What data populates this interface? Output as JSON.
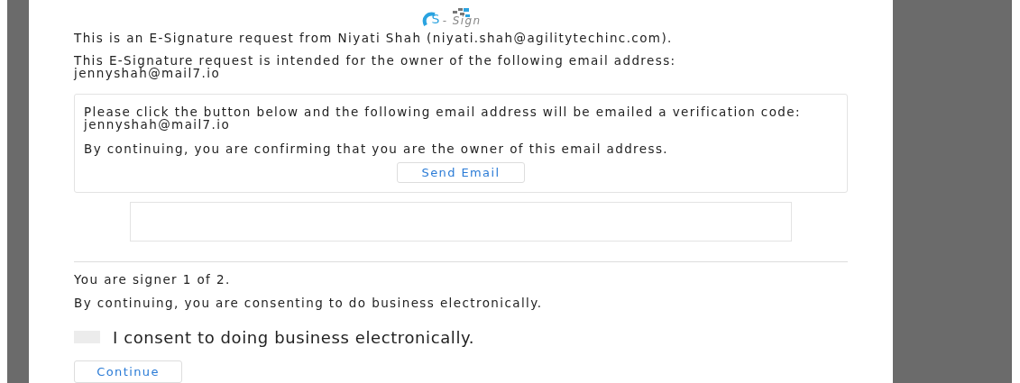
{
  "logo": {
    "letter": "S",
    "word": "- Sign"
  },
  "intro": "This is an E-Signature request from Niyati Shah (niyati.shah@agilitytechinc.com).",
  "intended": "This E-Signature request is intended for the owner of the following email address:",
  "intended_email": "jennyshah@mail7.io",
  "verify_card": {
    "text": "Please click the button below and the following email address will be emailed a verification code: jennyshah@mail7.io",
    "confirm": "By continuing, you are confirming that you are the owner of this email address.",
    "button": "Send Email"
  },
  "signer": "You are signer 1 of 2.",
  "consent_note": "By continuing, you are consenting to do business electronically.",
  "consent": {
    "label": "I consent to doing business electronically.",
    "checked": false
  },
  "continue_button": "Continue"
}
